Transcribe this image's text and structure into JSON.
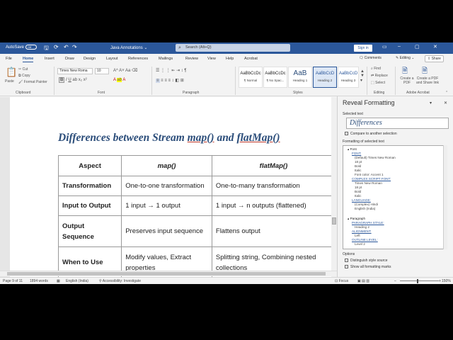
{
  "titlebar": {
    "autosave": "AutoSave",
    "autosave_state": "Off",
    "doc_name": "Java Annotations",
    "search": "Search (Alt+Q)",
    "signin": "Sign in"
  },
  "menu": {
    "tabs": [
      "File",
      "Home",
      "Insert",
      "Draw",
      "Design",
      "Layout",
      "References",
      "Mailings",
      "Review",
      "View",
      "Help",
      "Acrobat"
    ],
    "comments": "Comments",
    "editing": "Editing",
    "share": "Share"
  },
  "ribbon": {
    "paste": "Paste",
    "cut": "Cut",
    "copy": "Copy",
    "format_painter": "Format Painter",
    "clipboard": "Clipboard",
    "font_name": "Times New Roma",
    "font_size": "10",
    "font": "Font",
    "paragraph": "Paragraph",
    "styles_label": "Styles",
    "styles": [
      {
        "preview": "AaBbCcDc",
        "name": "¶ Normal"
      },
      {
        "preview": "AaBbCcDc",
        "name": "¶ No Spac..."
      },
      {
        "preview": "AaB",
        "name": "Heading 1"
      },
      {
        "preview": "AaBbCcD",
        "name": "Heading 2"
      },
      {
        "preview": "AaBbCcD",
        "name": "Heading 3"
      }
    ],
    "find": "Find",
    "replace": "Replace",
    "select": "Select",
    "editing": "Editing",
    "create_pdf": "Create a PDF",
    "create_pdf_share": "Create a PDF and Share link",
    "adobe": "Adobe Acrobat"
  },
  "document": {
    "title_pre": "Differences between Stream ",
    "title_map": "map()",
    "title_mid": " and ",
    "title_flatmap": "flatMap()",
    "table": {
      "headers": [
        "Aspect",
        "map()",
        "flatMap()"
      ],
      "rows": [
        [
          "Transformation",
          "One-to-one transformation",
          "One-to-many transformation"
        ],
        [
          "Input to Output",
          "1 input → 1 output",
          "1 input → n outputs (flattened)"
        ],
        [
          "Output Sequence",
          "Preserves input sequence",
          "Flattens output"
        ],
        [
          "When to Use",
          "Modify values, Extract properties",
          "Splitting string, Combining nested collections"
        ]
      ]
    }
  },
  "pane": {
    "title": "Reveal Formatting",
    "selected_text_label": "Selected text",
    "selected_text": "Differences",
    "compare": "Compare to another selection",
    "formatting_label": "Formatting of selected text",
    "font_section": "Font",
    "font_link": "FONT:",
    "font_items": [
      "(Default) Times New Roman",
      "18 pt",
      "Bold",
      "Italic",
      "Font color: Accent 1"
    ],
    "complex_link": "COMPLEX SCRIPT FONT:",
    "complex_items": [
      "Times New Roman",
      "18 pt",
      "Bold",
      "Italic"
    ],
    "language_link": "LANGUAGE:",
    "language_items": [
      "(Complex) Hindi",
      "English (India)"
    ],
    "paragraph_section": "Paragraph",
    "para_style_link": "PARAGRAPH STYLE:",
    "para_style_value": "Heading 2",
    "alignment_link": "ALIGNMENT:",
    "alignment_value": "Left",
    "outline_link": "OUTLINE LEVEL:",
    "outline_value": "Level 2",
    "options_label": "Options",
    "distinguish": "Distinguish style source",
    "show_all": "Show all formatting marks"
  },
  "status": {
    "page": "Page 9 of 11",
    "words": "1894 words",
    "language": "English (India)",
    "accessibility": "Accessibility: Investigate",
    "focus": "Focus",
    "zoom": "150%"
  }
}
